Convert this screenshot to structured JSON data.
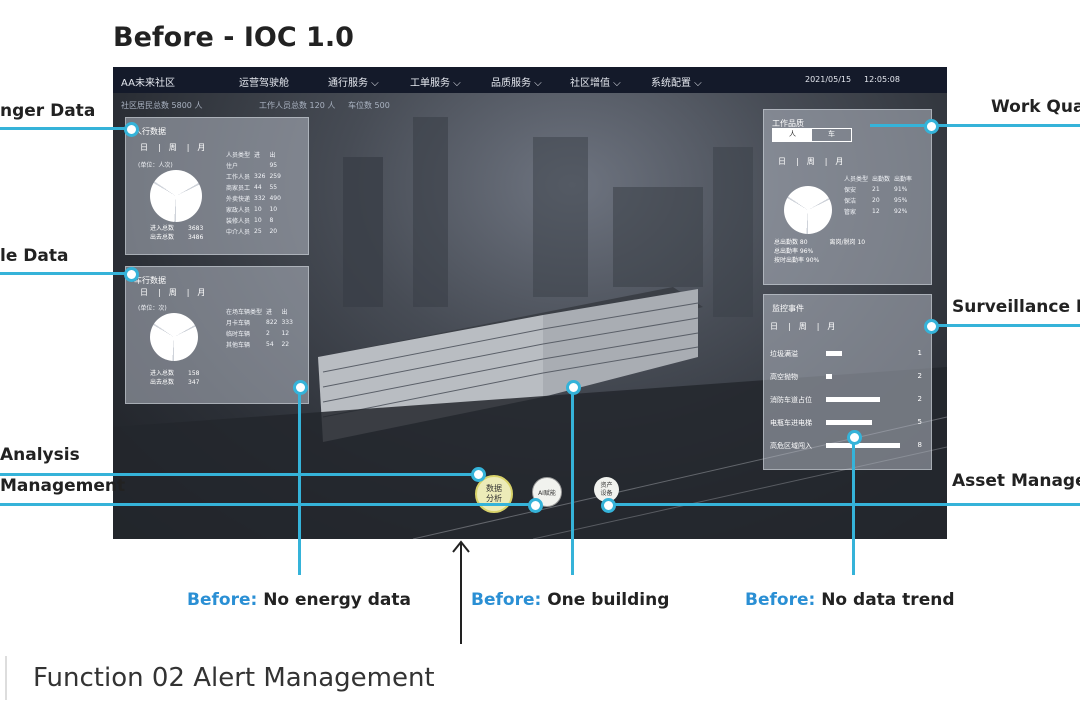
{
  "heading": "Before - IOC 1.0",
  "topbar": {
    "brand": "AA未来社区",
    "nav": [
      "运营驾驶舱",
      "通行服务 ⌵",
      "工单服务 ⌵",
      "品质服务 ⌵",
      "社区增值 ⌵",
      "系统配置 ⌵"
    ],
    "date": "2021/05/15",
    "time": "12:05:08"
  },
  "stats": [
    "社区居民总数 5800 人",
    "工作人员总数 120 人",
    "车位数 500"
  ],
  "people_panel": {
    "title": "人行数据",
    "tabs": [
      "日",
      "周",
      "月"
    ],
    "unit": "(单位：人次)",
    "headers": [
      "人员类型",
      "进",
      "出"
    ],
    "rows": [
      [
        "住户",
        "",
        "95"
      ],
      [
        "工作人员",
        "326",
        "259"
      ],
      [
        "商家员工",
        "44",
        "55"
      ],
      [
        "外卖快递",
        "332",
        "490"
      ],
      [
        "家政人员",
        "10",
        "10"
      ],
      [
        "装修人员",
        "10",
        "8"
      ],
      [
        "中介人员",
        "25",
        "20"
      ]
    ],
    "in_label": "进入总数",
    "in_value": "3683",
    "out_label": "出去总数",
    "out_value": "3486"
  },
  "vehicle_panel": {
    "title": "车行数据",
    "tabs": [
      "日",
      "周",
      "月"
    ],
    "unit": "(单位：次)",
    "headers": [
      "在场车辆类型",
      "进",
      "出"
    ],
    "rows": [
      [
        "月卡车辆",
        "822",
        "333"
      ],
      [
        "临时车辆",
        "2",
        "12"
      ],
      [
        "其他车辆",
        "54",
        "22"
      ]
    ],
    "in_label": "进入总数",
    "in_value": "158",
    "out_label": "出去总数",
    "out_value": "347"
  },
  "work_panel": {
    "title": "工作品质",
    "toggle": [
      "人",
      "车"
    ],
    "tabs": [
      "日",
      "周",
      "月"
    ],
    "headers": [
      "人员类型",
      "出勤数",
      "出勤率"
    ],
    "rows": [
      [
        "保安",
        "21",
        "91%"
      ],
      [
        "保洁",
        "20",
        "95%"
      ],
      [
        "管家",
        "12",
        "92%"
      ]
    ],
    "foot": [
      "总出勤数 80",
      "离岗/脱岗 10",
      "总出勤率 96%",
      "按时出勤率 90%"
    ]
  },
  "monitor_panel": {
    "title": "监控事件",
    "tabs": [
      "日",
      "周",
      "月"
    ],
    "rows": [
      {
        "label": "垃圾满溢",
        "value": "1",
        "level": 0.2
      },
      {
        "label": "高空抛物",
        "value": "2",
        "level": 0.07
      },
      {
        "label": "消防车道占位",
        "value": "2",
        "level": 0.68
      },
      {
        "label": "电瓶车进电梯",
        "value": "5",
        "level": 0.57
      },
      {
        "label": "高危区域闯入",
        "value": "8",
        "level": 0.92
      }
    ]
  },
  "bubbles": {
    "data": "数据\n分析",
    "ai": "AI赋能",
    "asset": "资产\n设备"
  },
  "callouts": {
    "passenger": "nger Data",
    "vehicle": "le Data",
    "analysis": "Analysis",
    "management": "Management",
    "work": "Work Qua",
    "surveillance": "Surveillance D",
    "asset": "Asset Manage"
  },
  "before": [
    {
      "prefix": "Before:",
      "text": " No energy data"
    },
    {
      "prefix": "Before:",
      "text": " One building"
    },
    {
      "prefix": "Before:",
      "text": " No data trend"
    }
  ],
  "footer": "Function 02 Alert Management",
  "colors": {
    "accent": "#35b3d9",
    "before": "#2a8fd4",
    "topbar": "#141a2a"
  }
}
